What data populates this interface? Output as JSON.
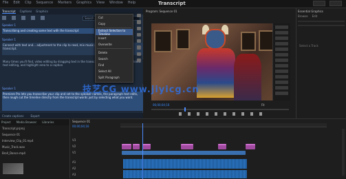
{
  "app": {
    "title": "Transcript",
    "menu": [
      "File",
      "Edit",
      "Clip",
      "Sequence",
      "Markers",
      "Graphics",
      "View",
      "Window",
      "Help"
    ]
  },
  "transcript_panel": {
    "tabs": [
      "Transcript",
      "Captions",
      "Graphics"
    ],
    "active_tab": "Transcript",
    "search_placeholder": "Search",
    "speakers": [
      "Speaker 1",
      "Speaker 1",
      "Speaker 1"
    ],
    "paragraphs": [
      "Transcribing and creating some text with the transcript",
      "Connect with text and... adjustment to the clip to read, mix music and timing the clip in this transcript.",
      "Many times you'll find, video editing by dragging text in the transcript through a workflow you know text editing, and highlight area to a caption",
      "Premiere Pro lets you transcribe your clip and set to the speaker names, the paragraph text edits, then rough cut the timeline directly from the transcript words just by selecting what you want."
    ],
    "footer": [
      "Create captions",
      "Export"
    ]
  },
  "context_menu": {
    "items": [
      "Cut",
      "Copy",
      "Extract Selection to Timeline",
      "Insert",
      "Overwrite",
      "Delete",
      "Search",
      "Find",
      "Select All",
      "Split Paragraph"
    ],
    "highlighted": "Extract Selection to Timeline"
  },
  "program_monitor": {
    "header": "Program: Sequence 01",
    "timecode": "00;00;04;16",
    "zoom": "Fit"
  },
  "right_panel": {
    "header": "Essential Graphics",
    "tabs": [
      "Browse",
      "Edit"
    ],
    "empty_text": "Select a Track"
  },
  "project_panel": {
    "tabs": [
      "Project",
      "Media Browser",
      "Libraries"
    ],
    "rows": [
      "Transcript.prproj",
      "Sequence 01",
      "Interview_Clip_01.mp4",
      "Music_Track.wav",
      "Broll_Dance.mp4"
    ]
  },
  "timeline": {
    "header": "Sequence 01",
    "timecode": "00;00;04;16",
    "tracks": [
      "V3",
      "V2",
      "V1",
      "A1",
      "A2",
      "A3"
    ]
  },
  "watermark": {
    "text": "技艺CG www.jiyicg.cn"
  },
  "colors": {
    "accent": "#4c8cff",
    "transcript_bg": "#1e2a3a",
    "video_clip": "#a04aa0",
    "audio_clip": "#3a6fb0"
  }
}
